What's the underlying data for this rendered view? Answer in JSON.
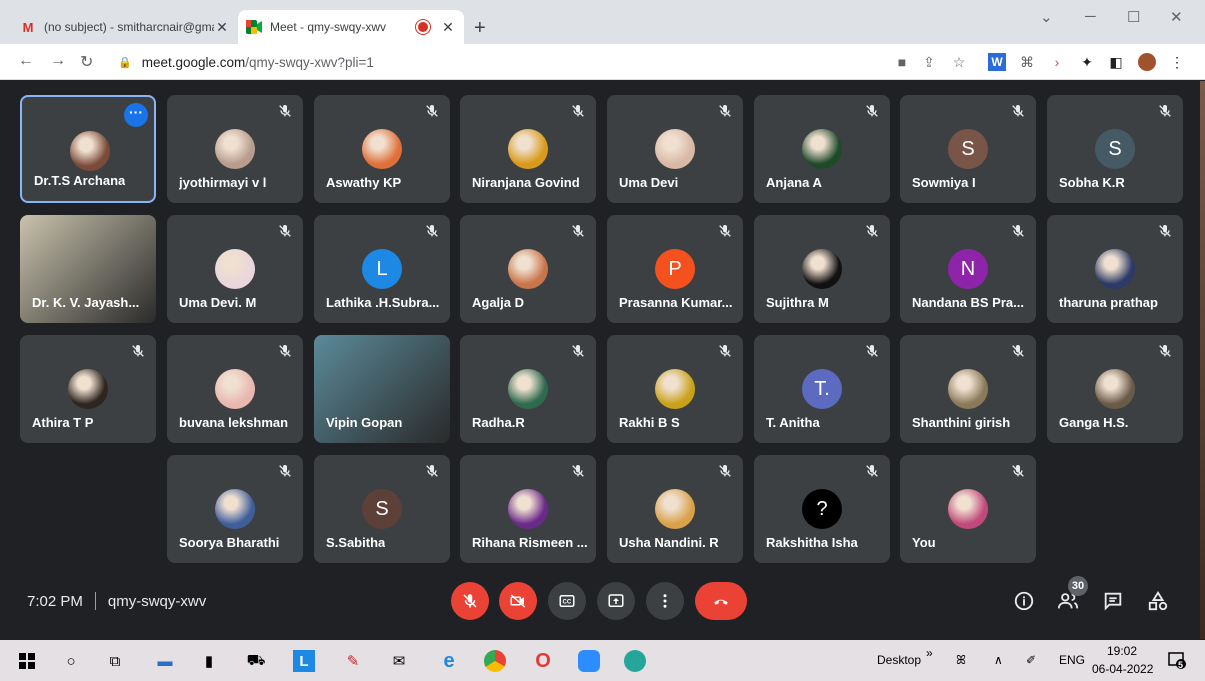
{
  "browser": {
    "tabs": [
      {
        "label": "(no subject) - smitharcnair@gma",
        "favicon": "gmail-icon",
        "active": false
      },
      {
        "label": "Meet - qmy-swqy-xwv",
        "favicon": "meet-icon",
        "active": true
      }
    ],
    "new_tab": "+",
    "window_controls": {
      "minimize": "─",
      "maximize": "☐",
      "close": "✕",
      "dropdown": "⌄"
    },
    "url_host": "meet.google.com",
    "url_path": "/qmy-swqy-xwv?pli=1"
  },
  "meeting": {
    "participants": [
      {
        "name": "Dr.T.S Archana",
        "avatar": "photo",
        "color": "#7b4a3a",
        "muted": false,
        "selected": true
      },
      {
        "name": "jyothirmayi v l",
        "avatar": "photo",
        "color": "#b79c8f",
        "muted": true
      },
      {
        "name": "Aswathy KP",
        "avatar": "photo",
        "color": "#e0703a",
        "muted": true
      },
      {
        "name": "Niranjana Govind",
        "avatar": "photo",
        "color": "#d89a1a",
        "muted": true
      },
      {
        "name": "Uma Devi",
        "avatar": "photo",
        "color": "#d9b9a6",
        "muted": true
      },
      {
        "name": "Anjana A",
        "avatar": "photo",
        "color": "#1f4a2a",
        "muted": true
      },
      {
        "name": "Sowmiya I",
        "avatar": "S",
        "color": "#795548",
        "muted": true
      },
      {
        "name": "Sobha K.R",
        "avatar": "S",
        "color": "#455a64",
        "muted": true
      },
      {
        "name": "Dr. K. V. Jayash...",
        "avatar": "video",
        "color": "#c9c3ad",
        "muted": false
      },
      {
        "name": "Uma Devi. M",
        "avatar": "photo",
        "color": "#e8d6dc",
        "muted": true
      },
      {
        "name": "Lathika .H.Subra...",
        "avatar": "L",
        "color": "#1e88e5",
        "muted": true
      },
      {
        "name": "Agalja D",
        "avatar": "photo",
        "color": "#c8754a",
        "muted": true
      },
      {
        "name": "Prasanna Kumar...",
        "avatar": "P",
        "color": "#f4511e",
        "muted": true
      },
      {
        "name": "Sujithra M",
        "avatar": "photo",
        "color": "#111111",
        "muted": true
      },
      {
        "name": "Nandana BS Pra...",
        "avatar": "N",
        "color": "#8e24aa",
        "muted": true
      },
      {
        "name": "tharuna prathap",
        "avatar": "photo",
        "color": "#2b3a66",
        "muted": true
      },
      {
        "name": "Athira T P",
        "avatar": "photo",
        "color": "#2d2520",
        "muted": true
      },
      {
        "name": "buvana lekshman",
        "avatar": "photo",
        "color": "#e8b7b0",
        "muted": true
      },
      {
        "name": "Vipin Gopan",
        "avatar": "video",
        "color": "#5b8a9a",
        "muted": false
      },
      {
        "name": "Radha.R",
        "avatar": "photo",
        "color": "#2e6a4e",
        "muted": true
      },
      {
        "name": "Rakhi B S",
        "avatar": "photo",
        "color": "#c9a21a",
        "muted": true
      },
      {
        "name": "T. Anitha",
        "avatar": "T.",
        "color": "#5c6bc0",
        "muted": true
      },
      {
        "name": "Shanthini girish",
        "avatar": "photo",
        "color": "#8a7a5a",
        "muted": true
      },
      {
        "name": "Ganga H.S.",
        "avatar": "photo",
        "color": "#6a5a4a",
        "muted": true
      },
      {
        "name": "Soorya Bharathi",
        "avatar": "photo",
        "color": "#3f5f9a",
        "muted": true
      },
      {
        "name": "S.Sabitha",
        "avatar": "S",
        "color": "#5d4037",
        "muted": true
      },
      {
        "name": "Rihana Rismeen ...",
        "avatar": "photo",
        "color": "#6a2a8a",
        "muted": true
      },
      {
        "name": "Usha Nandini. R",
        "avatar": "photo",
        "color": "#d9a24a",
        "muted": true
      },
      {
        "name": "Rakshitha Isha",
        "avatar": "?",
        "color": "#000000",
        "muted": true
      },
      {
        "name": "You",
        "avatar": "photo",
        "color": "#c04a7a",
        "muted": true
      }
    ],
    "time": "7:02 PM",
    "code": "qmy-swqy-xwv",
    "participant_count": "30"
  },
  "taskbar": {
    "desktop_label": "Desktop",
    "chevron": "»",
    "language": "ENG",
    "time": "19:02",
    "date": "06-04-2022",
    "notifications": "5"
  }
}
